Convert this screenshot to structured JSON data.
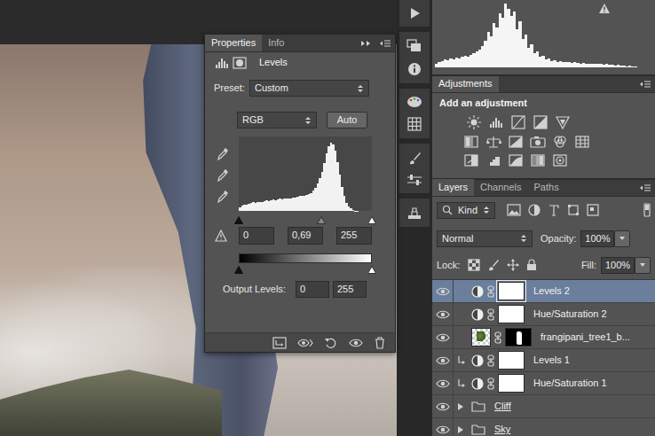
{
  "properties_panel": {
    "tabs": [
      {
        "label": "Properties",
        "selected": true
      },
      {
        "label": "Info",
        "selected": false
      }
    ],
    "title": "Levels",
    "preset_label": "Preset:",
    "preset_value": "Custom",
    "channel": "RGB",
    "auto_button": "Auto",
    "histogram": {
      "values": [
        6,
        8,
        10,
        9,
        11,
        12,
        13,
        12,
        14,
        13,
        14,
        15,
        16,
        15,
        16,
        17,
        16,
        17,
        18,
        17,
        18,
        19,
        18,
        19,
        20,
        20,
        21,
        22,
        22,
        23,
        24,
        25,
        27,
        30,
        34,
        40,
        48,
        58,
        70,
        84,
        95,
        100,
        97,
        88,
        72,
        54,
        36,
        22,
        12,
        7,
        4,
        2,
        1,
        1,
        0,
        0,
        0,
        0,
        0,
        0
      ]
    },
    "input_sliders": [
      {
        "level": 0
      },
      {
        "level": 0.62
      },
      {
        "level": 1
      }
    ],
    "input_levels": [
      "0",
      "0,69",
      "255"
    ],
    "output_label": "Output Levels:",
    "output_sliders": [
      {
        "level": 0
      },
      {
        "level": 1
      }
    ],
    "output_levels": [
      "0",
      "255"
    ]
  },
  "histogram_panel": {
    "values": [
      5,
      8,
      10,
      12,
      11,
      14,
      13,
      15,
      14,
      16,
      18,
      17,
      20,
      22,
      25,
      28,
      34,
      42,
      55,
      48,
      70,
      62,
      85,
      78,
      100,
      92,
      80,
      88,
      60,
      72,
      45,
      52,
      30,
      36,
      22,
      25,
      16,
      18,
      12,
      14,
      10,
      11,
      9,
      10,
      8,
      9,
      8,
      7,
      8,
      7,
      6,
      7,
      6,
      6,
      5,
      6,
      5,
      5,
      4,
      5,
      4,
      4,
      3,
      4,
      3,
      3,
      2,
      3,
      2,
      2
    ]
  },
  "adjustments": {
    "tab": "Adjustments",
    "heading": "Add an adjustment"
  },
  "layers_panel": {
    "tabs": [
      {
        "label": "Layers",
        "selected": true
      },
      {
        "label": "Channels",
        "selected": false
      },
      {
        "label": "Paths",
        "selected": false
      }
    ],
    "filter": "Kind",
    "blend_mode": "Normal",
    "opacity_label": "Opacity:",
    "opacity": "100%",
    "lock_label": "Lock:",
    "fill_label": "Fill:",
    "fill": "100%",
    "layers": [
      {
        "name": "Levels 2",
        "kind": "adjustment",
        "selected": true,
        "visible": true,
        "clipped": false
      },
      {
        "name": "Hue/Saturation 2",
        "kind": "adjustment",
        "selected": false,
        "visible": true,
        "clipped": false
      },
      {
        "name": "frangipani_tree1_b...",
        "kind": "image",
        "selected": false,
        "visible": true,
        "clipped": false
      },
      {
        "name": "Levels 1",
        "kind": "adjustment",
        "selected": false,
        "visible": true,
        "clipped": true
      },
      {
        "name": "Hue/Saturation 1",
        "kind": "adjustment",
        "selected": false,
        "visible": true,
        "clipped": true
      },
      {
        "name": "Cliff",
        "kind": "group",
        "selected": false,
        "visible": true,
        "clipped": false,
        "expanded": false
      },
      {
        "name": "Sky",
        "kind": "group",
        "selected": false,
        "visible": true,
        "clipped": false,
        "expanded": false
      }
    ]
  }
}
